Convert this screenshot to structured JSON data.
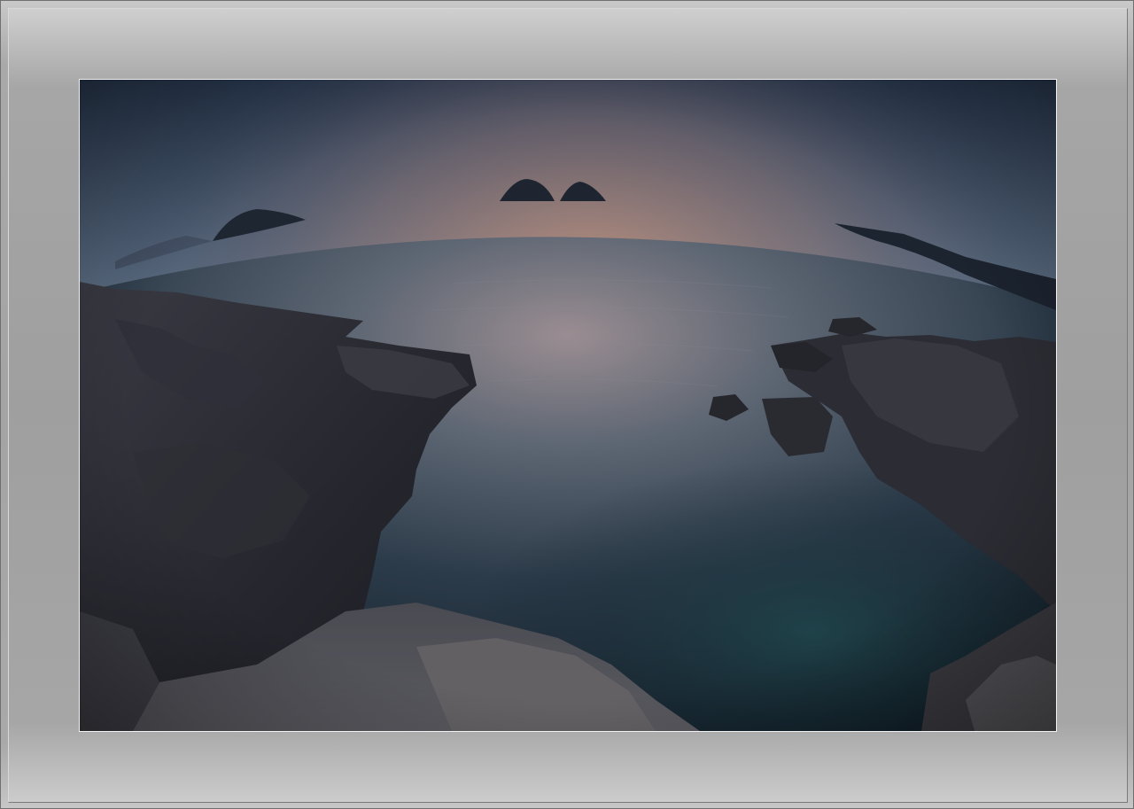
{
  "photo": {
    "subject": "",
    "colors": {
      "sky_top": "#2a3a52",
      "horizon_glow": "#d99a7a",
      "sea": "#2c3b4a",
      "rock": "#2b2b33"
    }
  }
}
